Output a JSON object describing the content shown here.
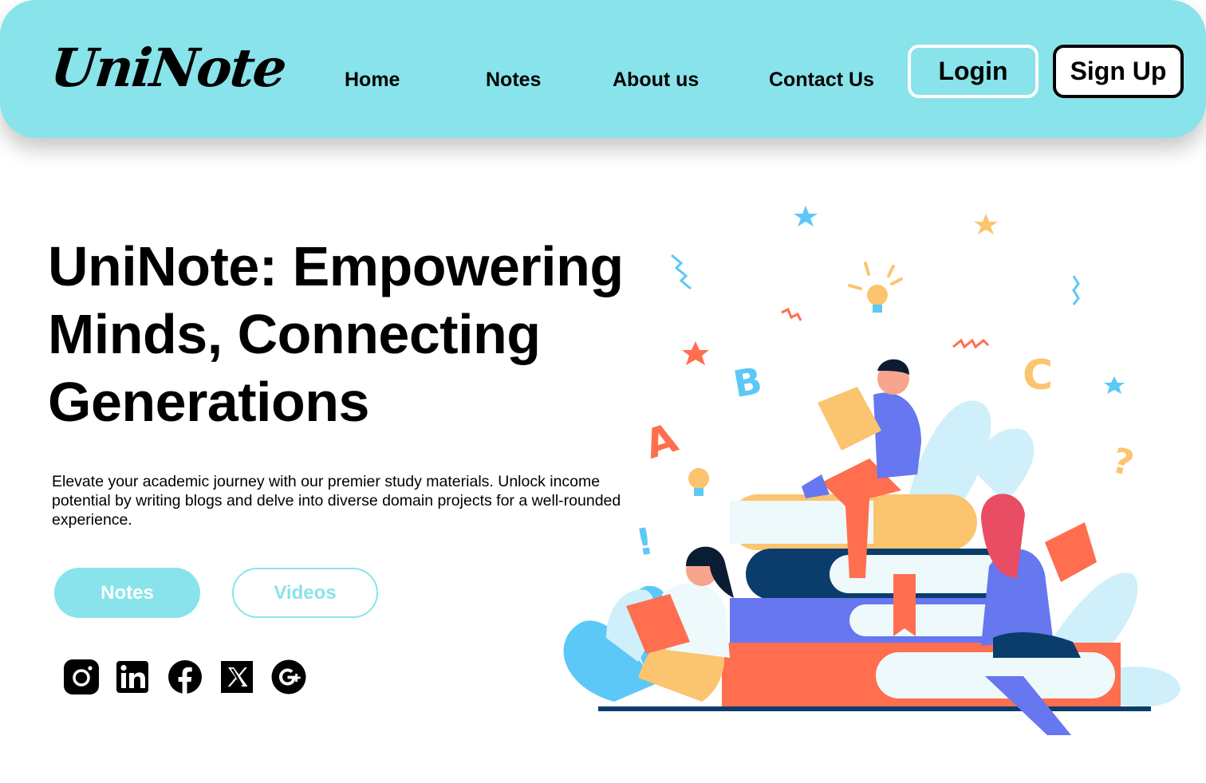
{
  "brand": {
    "logo_text": "UniNote"
  },
  "nav": {
    "links": [
      "Home",
      "Notes",
      "About us",
      "Contact Us"
    ],
    "login_label": "Login",
    "signup_label": "Sign Up"
  },
  "hero": {
    "title": "UniNote: Empowering Minds, Connecting Generations",
    "description": "Elevate your academic journey with our premier study materials. Unlock income potential by writing blogs and delve into diverse domain projects for a well-rounded experience.",
    "primary_button": "Notes",
    "secondary_button": "Videos"
  },
  "social_icons": [
    "instagram-icon",
    "linkedin-icon",
    "facebook-icon",
    "x-icon",
    "google-plus-icon"
  ],
  "illustration": {
    "letters": [
      "A",
      "B",
      "C"
    ],
    "symbols": [
      "?",
      "!"
    ]
  },
  "colors": {
    "accent": "#89E3EA",
    "text": "#000000",
    "background": "#FFFFFF"
  }
}
